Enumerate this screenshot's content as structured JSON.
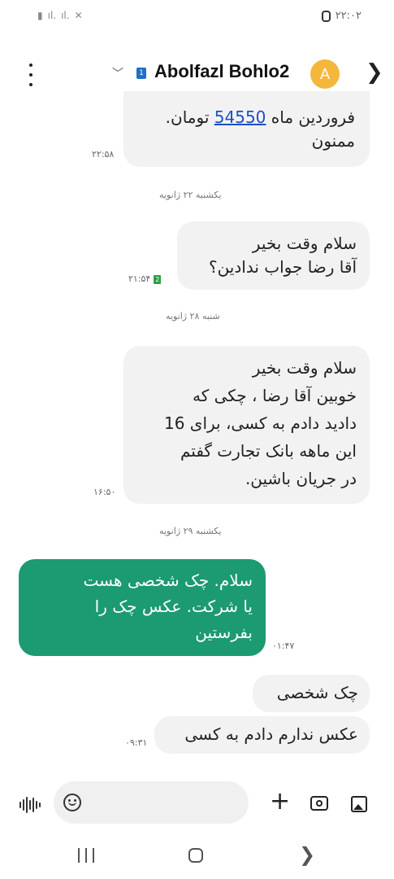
{
  "status_bar": {
    "time": "۲۲:۰۲"
  },
  "header": {
    "sim_label": "1",
    "contact_name": "Abolfazl Bohlo2",
    "avatar_letter": "A"
  },
  "messages": [
    {
      "direction": "in",
      "line1_pre": "فروردین ماه ",
      "link": "54550",
      "line1_post": " تومان.",
      "line2": "ممنون",
      "time": "۲۲:۵۸"
    },
    {
      "type": "date",
      "text": "یکشنبه ۲۲ ژانویه"
    },
    {
      "direction": "in",
      "text": "سلام وقت بخیر\nآقا رضا جواب ندادین؟",
      "time": "۲۱:۵۴",
      "sim": "2"
    },
    {
      "type": "date",
      "text": "شنبه ۲۸ ژانویه"
    },
    {
      "direction": "in",
      "text": "سلام وقت بخیر\nخوبین آقا رضا ، چکی که\nدادید دادم به کسی، برای 16\nاین ماهه بانک تجارت گفتم\nدر جریان باشین.",
      "time": "۱۶:۵۰"
    },
    {
      "type": "date",
      "text": "یکشنبه ۲۹ ژانویه"
    },
    {
      "direction": "out",
      "text": "سلام. چک شخصی هست\nیا شرکت. عکس چک را\nبفرستین",
      "time": "۰۱:۴۷"
    },
    {
      "direction": "in",
      "text": "چک شخصی"
    },
    {
      "direction": "in",
      "text": "عکس ندارم دادم به کسی",
      "time": "۰۹:۳۱"
    }
  ],
  "colors": {
    "outgoing_bubble": "#1c9a72",
    "incoming_bubble": "#f2f2f2",
    "avatar": "#f5b73b",
    "link": "#1e4fc4"
  },
  "icons": [
    "voice-icon",
    "emoji-icon",
    "plus-icon",
    "camera-icon",
    "gallery-icon",
    "more-options-icon",
    "chevron-down-icon",
    "chevron-right-icon"
  ]
}
